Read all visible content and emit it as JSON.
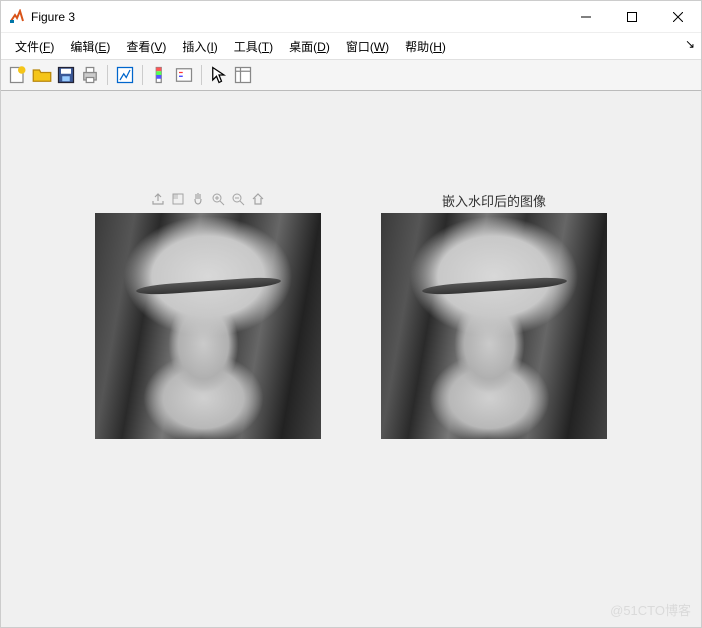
{
  "window": {
    "title": "Figure 3",
    "minimize": "—",
    "maximize": "☐",
    "close": "✕"
  },
  "menu": {
    "file": "文件",
    "file_u": "F",
    "edit": "编辑",
    "edit_u": "E",
    "view": "查看",
    "view_u": "V",
    "insert": "插入",
    "insert_u": "I",
    "tools": "工具",
    "tools_u": "T",
    "desktop": "桌面",
    "desktop_u": "D",
    "window": "窗口",
    "window_u": "W",
    "help": "帮助",
    "help_u": "H"
  },
  "plots": {
    "left_title": "",
    "right_title": "嵌入水印后的图像"
  },
  "watermark": "@51CTO博客"
}
